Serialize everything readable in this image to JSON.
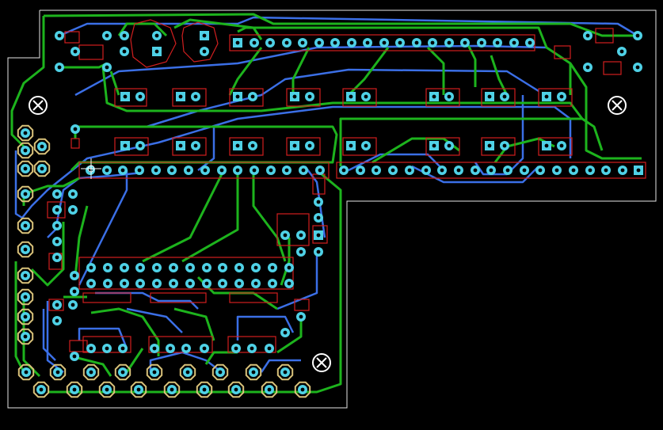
{
  "app": {
    "title": "",
    "grid_visible": false
  },
  "colors": {
    "background": "#000000",
    "outline": "#e6e6e6",
    "top_trace": "#1db31d",
    "bottom_trace": "#3b6fe6",
    "pad": "#4fd1e6",
    "pad_hole": "#000000",
    "silk": "#d11f1f",
    "gold_pad": "#d9c27a",
    "mount_hole": "#ffffff",
    "cursor": "#ffffff"
  },
  "icons": {
    "cursor": "crosshair-cursor-icon",
    "mount": "mounting-hole-icon"
  },
  "board": {
    "layers": [
      "top",
      "bottom"
    ],
    "outline_shape": "L-shaped PCB outline"
  }
}
